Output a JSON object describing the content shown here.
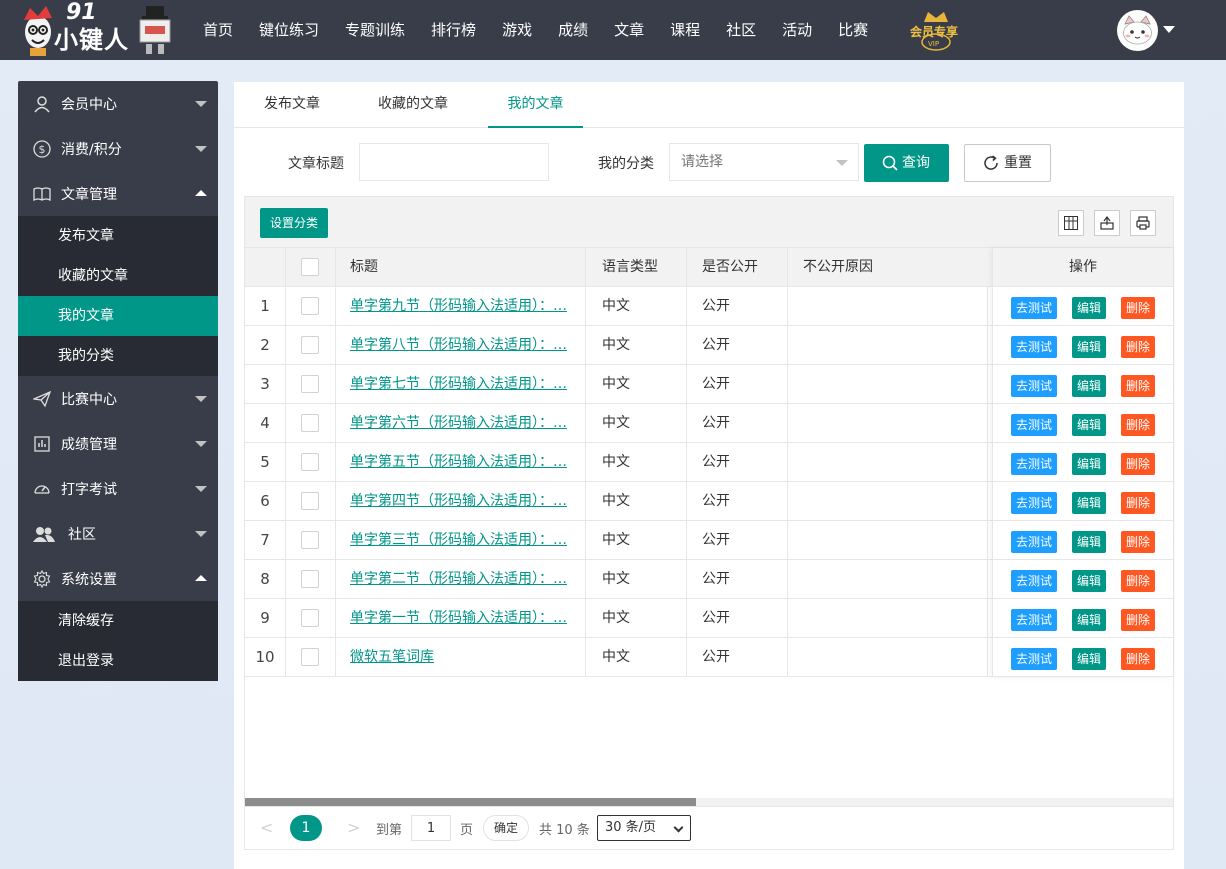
{
  "logo": {
    "number": "91",
    "name": "小键人"
  },
  "nav": {
    "items": [
      "首页",
      "键位练习",
      "专题训练",
      "排行榜",
      "游戏",
      "成绩",
      "文章",
      "课程",
      "社区",
      "活动",
      "比赛"
    ],
    "vip_label": "会员专享",
    "vip_sub": "VIP"
  },
  "sidebar": {
    "groups": [
      {
        "label": "会员中心",
        "icon": "user-icon",
        "expanded": false
      },
      {
        "label": "消费/积分",
        "icon": "dollar-icon",
        "expanded": false
      },
      {
        "label": "文章管理",
        "icon": "book-icon",
        "expanded": true,
        "items": [
          "发布文章",
          "收藏的文章",
          "我的文章",
          "我的分类"
        ],
        "active": "我的文章"
      },
      {
        "label": "比赛中心",
        "icon": "paper-plane-icon",
        "expanded": false
      },
      {
        "label": "成绩管理",
        "icon": "chart-icon",
        "expanded": false
      },
      {
        "label": "打字考试",
        "icon": "dashboard-icon",
        "expanded": false
      },
      {
        "label": "社区",
        "icon": "users-icon",
        "expanded": false
      },
      {
        "label": "系统设置",
        "icon": "gear-icon",
        "expanded": true,
        "items": [
          "清除缓存",
          "退出登录"
        ]
      }
    ]
  },
  "tabs": [
    "发布文章",
    "收藏的文章",
    "我的文章"
  ],
  "active_tab": "我的文章",
  "filter": {
    "title_label": "文章标题",
    "title_value": "",
    "category_label": "我的分类",
    "category_placeholder": "请选择",
    "query_label": "查询",
    "reset_label": "重置"
  },
  "toolbar": {
    "set_category_label": "设置分类"
  },
  "table": {
    "columns": [
      "标题",
      "语言类型",
      "是否公开",
      "不公开原因",
      "操作"
    ],
    "rows": [
      {
        "no": "1",
        "title": "单字第九节（形码输入法适用）：…",
        "lang": "中文",
        "public": "公开",
        "reason": ""
      },
      {
        "no": "2",
        "title": "单字第八节（形码输入法适用）：…",
        "lang": "中文",
        "public": "公开",
        "reason": ""
      },
      {
        "no": "3",
        "title": "单字第七节（形码输入法适用）：…",
        "lang": "中文",
        "public": "公开",
        "reason": ""
      },
      {
        "no": "4",
        "title": "单字第六节（形码输入法适用）：…",
        "lang": "中文",
        "public": "公开",
        "reason": ""
      },
      {
        "no": "5",
        "title": "单字第五节（形码输入法适用）：…",
        "lang": "中文",
        "public": "公开",
        "reason": ""
      },
      {
        "no": "6",
        "title": "单字第四节（形码输入法适用）：…",
        "lang": "中文",
        "public": "公开",
        "reason": ""
      },
      {
        "no": "7",
        "title": "单字第三节（形码输入法适用）：…",
        "lang": "中文",
        "public": "公开",
        "reason": ""
      },
      {
        "no": "8",
        "title": "单字第二节（形码输入法适用）：…",
        "lang": "中文",
        "public": "公开",
        "reason": ""
      },
      {
        "no": "9",
        "title": "单字第一节（形码输入法适用）：…",
        "lang": "中文",
        "public": "公开",
        "reason": ""
      },
      {
        "no": "10",
        "title": "微软五笔词库",
        "lang": "中文",
        "public": "公开",
        "reason": ""
      }
    ],
    "actions": {
      "test": "去测试",
      "edit": "编辑",
      "delete": "删除"
    }
  },
  "pager": {
    "prev": "<",
    "next": ">",
    "current": "1",
    "goto_label": "到第",
    "goto_value": "1",
    "page_unit": "页",
    "ok_label": "确定",
    "total": "共 10 条",
    "page_size": "30 条/页"
  },
  "colors": {
    "primary": "#009688",
    "blue": "#1e9fff",
    "danger": "#ff5722",
    "header": "#393d49",
    "submenu": "#282b33"
  }
}
